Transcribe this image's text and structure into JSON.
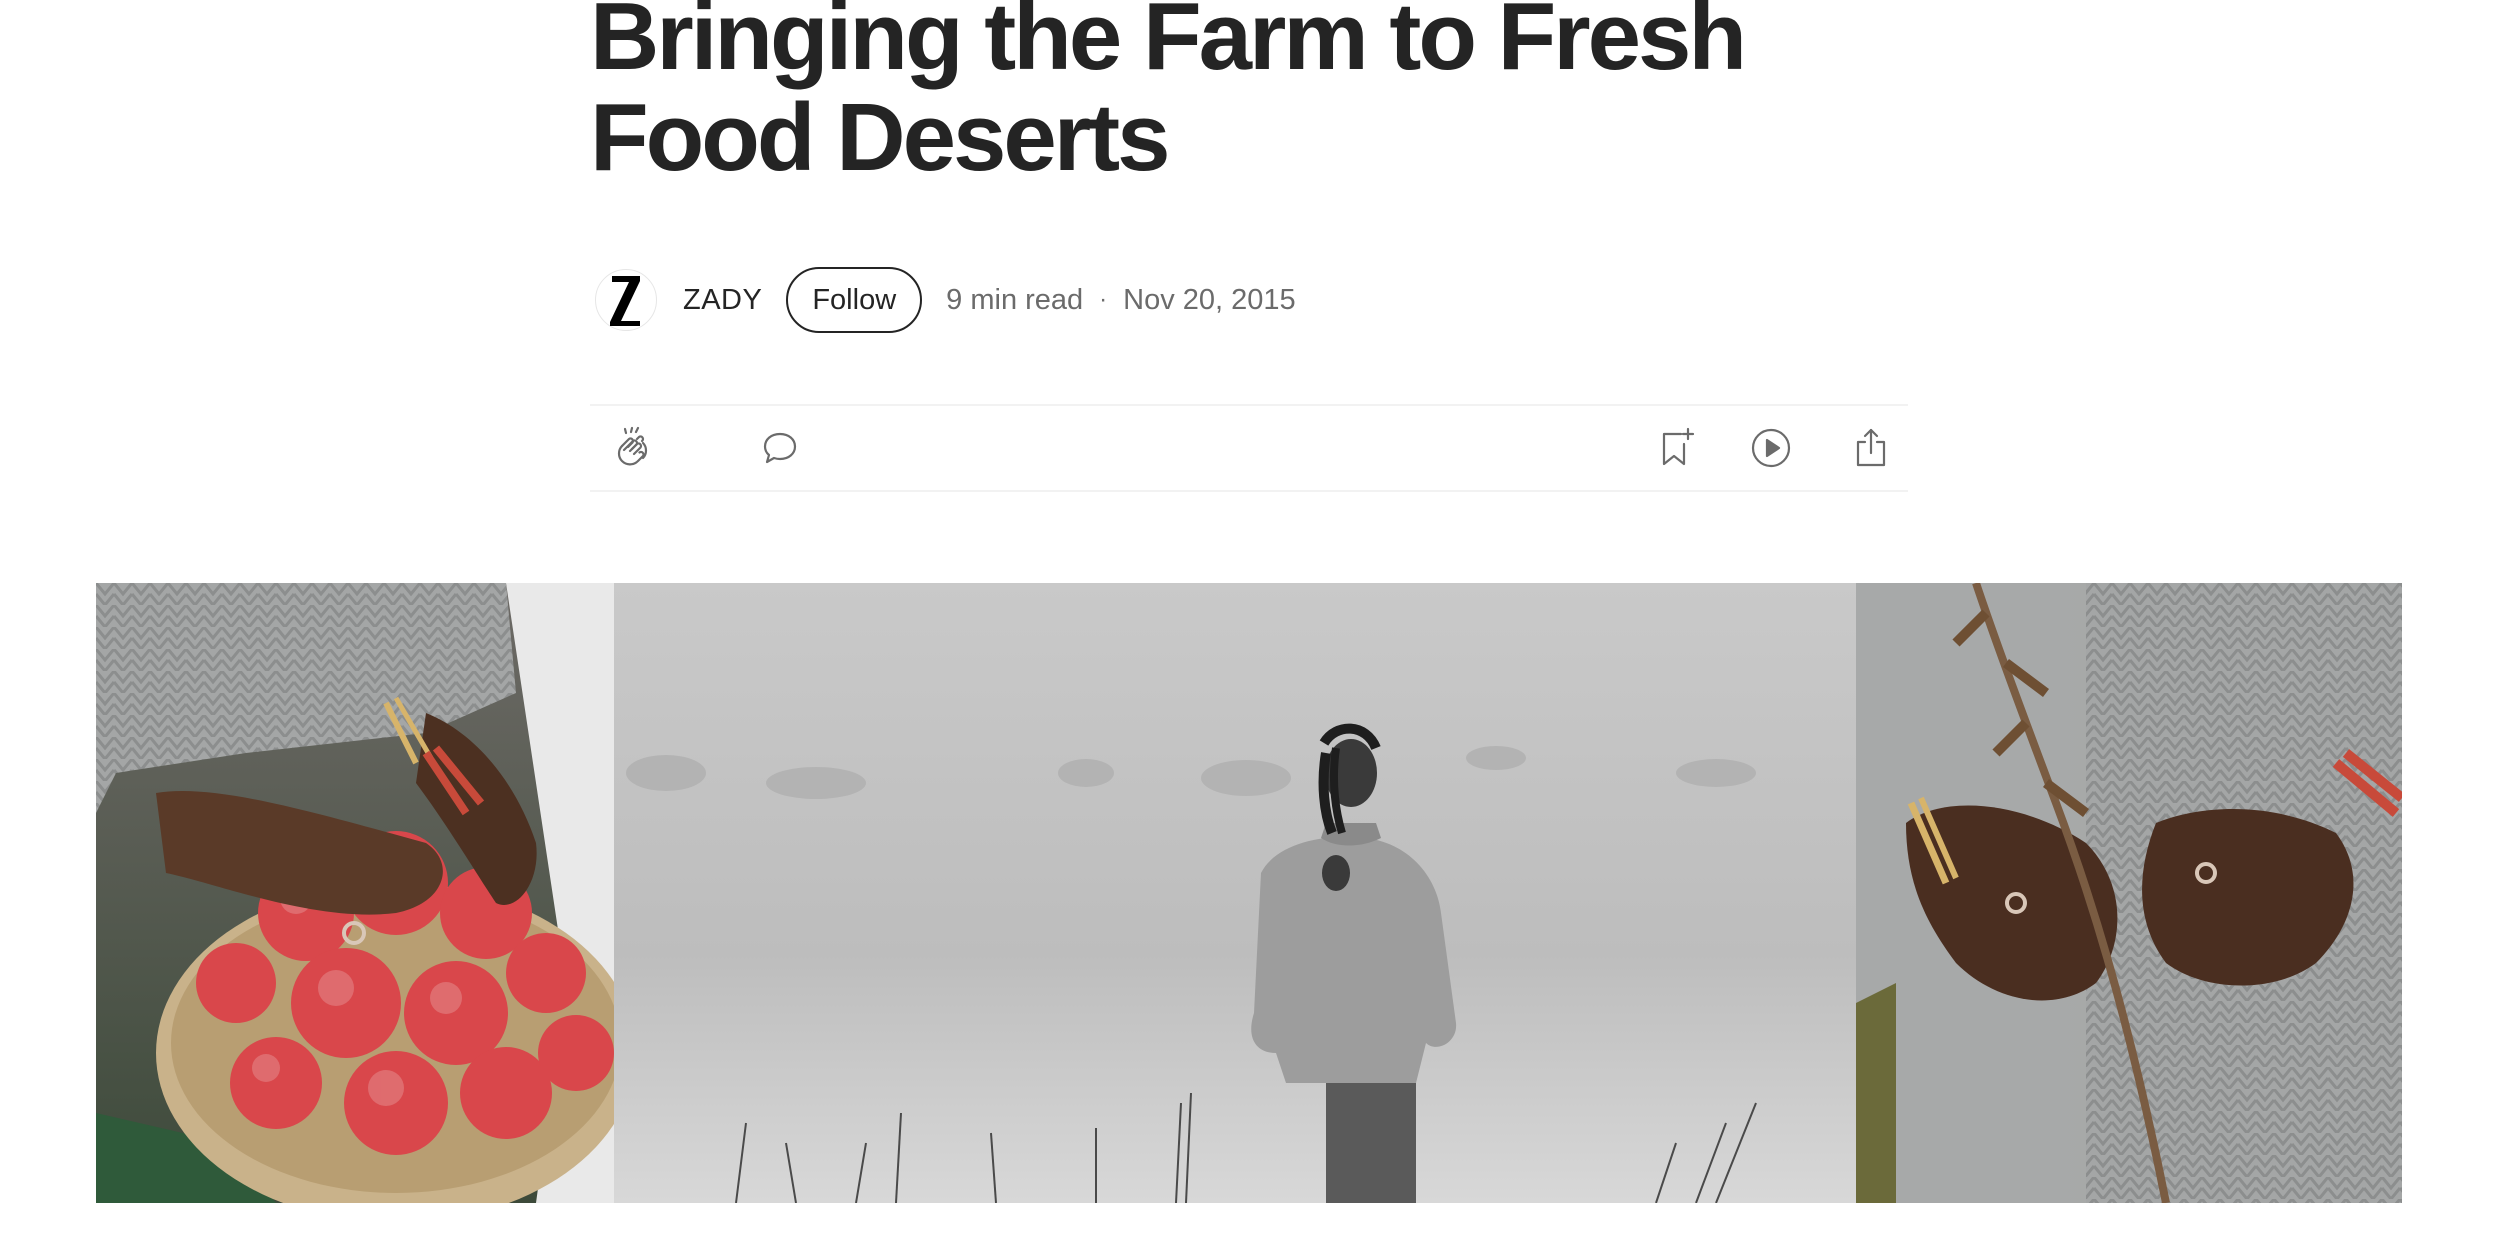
{
  "article": {
    "title": "Bringing the Farm to Fresh Food Deserts"
  },
  "author": {
    "name": "ZADY",
    "avatar_letter": "Z",
    "follow_label": "Follow"
  },
  "meta": {
    "read_time": "9 min read",
    "separator": "·",
    "date": "Nov 20, 2015"
  },
  "actions": {
    "left": [
      {
        "icon": "clap-icon"
      },
      {
        "icon": "comment-icon"
      }
    ],
    "right": [
      {
        "icon": "bookmark-add-icon"
      },
      {
        "icon": "play-icon"
      },
      {
        "icon": "share-icon"
      }
    ]
  },
  "hero_image": {
    "panels": [
      {
        "description_icon": "apples-basket-photo"
      },
      {
        "description_icon": "woman-in-field-photo"
      },
      {
        "description_icon": "hands-holding-stem-photo"
      }
    ]
  },
  "colors": {
    "text": "#242424",
    "meta": "#6b6b6b",
    "divider": "#f2f2f2",
    "icon": "#6b6b6b"
  }
}
